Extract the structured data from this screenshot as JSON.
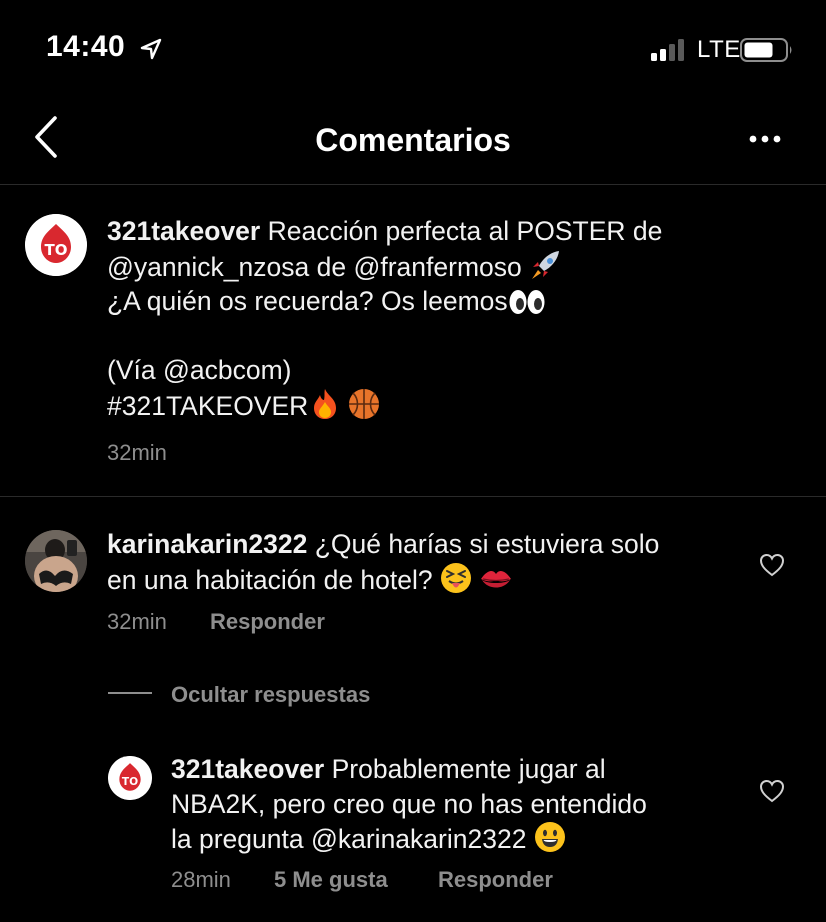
{
  "status_bar": {
    "time": "14:40",
    "network": "LTE"
  },
  "header": {
    "title": "Comentarios"
  },
  "caption": {
    "username": "321takeover",
    "line1_text": "Reacción perfecta al POSTER de",
    "mention1": "@yannick_nzosa",
    "connector": "de",
    "mention2": "@franfermoso",
    "line3": "¿A quién os recuerda? Os leemos",
    "line4": "(Vía @acbcom)",
    "line5": "#321TAKEOVER",
    "time": "32min"
  },
  "comment": {
    "username": "karinakarin2322",
    "line1_text": "¿Qué harías si estuviera solo",
    "line2": "en una habitación de hotel?",
    "time": "32min",
    "reply_label": "Responder"
  },
  "replies_toggle": {
    "label": "Ocultar respuestas"
  },
  "reply": {
    "username": "321takeover",
    "line1_text": "Probablemente jugar al",
    "line2": "NBA2K, pero creo que no has entendido",
    "line3": "la pregunta @karinakarin2322",
    "time": "28min",
    "likes": "5 Me gusta",
    "reply_label": "Responder"
  },
  "icons": {
    "status": [
      "location-arrow-icon",
      "signal-icon",
      "battery-icon"
    ],
    "header": [
      "back-chevron-icon",
      "more-options-icon"
    ],
    "emojis": [
      "rocket-emoji-icon",
      "eyes-emoji-icon",
      "fire-emoji-icon",
      "basketball-emoji-icon",
      "tongue-wink-emoji-icon",
      "kiss-mark-emoji-icon",
      "smile-emoji-icon"
    ],
    "actions": [
      "heart-icon"
    ]
  },
  "colors": {
    "background": "#000000",
    "text": "#f2f2f2",
    "muted": "#8e8e8e",
    "brand_red": "#d9282f"
  }
}
